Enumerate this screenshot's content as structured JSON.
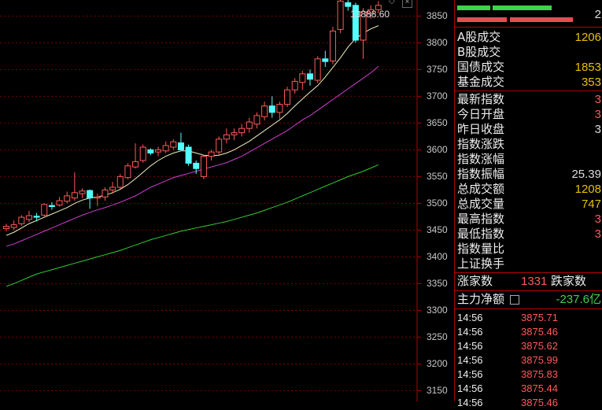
{
  "chart": {
    "high_marker": "13888.60",
    "y_ticks": [
      "3850",
      "3800",
      "3750",
      "3700",
      "3650",
      "3600",
      "3550",
      "3500",
      "3450",
      "3400",
      "3350",
      "3300",
      "3250",
      "3200",
      "3150"
    ],
    "ylim": [
      3130,
      3880
    ],
    "candles": [
      {
        "o": 3453,
        "h": 3462,
        "l": 3448,
        "c": 3457
      },
      {
        "o": 3455,
        "h": 3468,
        "l": 3450,
        "c": 3460
      },
      {
        "o": 3462,
        "h": 3478,
        "l": 3458,
        "c": 3474
      },
      {
        "o": 3470,
        "h": 3486,
        "l": 3465,
        "c": 3477
      },
      {
        "o": 3476,
        "h": 3482,
        "l": 3466,
        "c": 3474
      },
      {
        "o": 3478,
        "h": 3500,
        "l": 3474,
        "c": 3498
      },
      {
        "o": 3496,
        "h": 3502,
        "l": 3488,
        "c": 3494
      },
      {
        "o": 3497,
        "h": 3512,
        "l": 3494,
        "c": 3505
      },
      {
        "o": 3504,
        "h": 3522,
        "l": 3500,
        "c": 3514
      },
      {
        "o": 3510,
        "h": 3558,
        "l": 3505,
        "c": 3520
      },
      {
        "o": 3518,
        "h": 3528,
        "l": 3510,
        "c": 3523
      },
      {
        "o": 3524,
        "h": 3526,
        "l": 3490,
        "c": 3510
      },
      {
        "o": 3510,
        "h": 3518,
        "l": 3495,
        "c": 3512
      },
      {
        "o": 3512,
        "h": 3530,
        "l": 3505,
        "c": 3525
      },
      {
        "o": 3525,
        "h": 3540,
        "l": 3518,
        "c": 3530
      },
      {
        "o": 3530,
        "h": 3555,
        "l": 3526,
        "c": 3550
      },
      {
        "o": 3548,
        "h": 3575,
        "l": 3545,
        "c": 3570
      },
      {
        "o": 3568,
        "h": 3612,
        "l": 3565,
        "c": 3578
      },
      {
        "o": 3580,
        "h": 3610,
        "l": 3576,
        "c": 3605
      },
      {
        "o": 3600,
        "h": 3603,
        "l": 3590,
        "c": 3594
      },
      {
        "o": 3596,
        "h": 3606,
        "l": 3588,
        "c": 3600
      },
      {
        "o": 3598,
        "h": 3616,
        "l": 3594,
        "c": 3608
      },
      {
        "o": 3605,
        "h": 3620,
        "l": 3600,
        "c": 3615
      },
      {
        "o": 3613,
        "h": 3632,
        "l": 3605,
        "c": 3600
      },
      {
        "o": 3605,
        "h": 3610,
        "l": 3570,
        "c": 3575
      },
      {
        "o": 3575,
        "h": 3580,
        "l": 3555,
        "c": 3565
      },
      {
        "o": 3550,
        "h": 3590,
        "l": 3545,
        "c": 3588
      },
      {
        "o": 3588,
        "h": 3600,
        "l": 3580,
        "c": 3596
      },
      {
        "o": 3596,
        "h": 3625,
        "l": 3590,
        "c": 3620
      },
      {
        "o": 3620,
        "h": 3640,
        "l": 3612,
        "c": 3628
      },
      {
        "o": 3628,
        "h": 3640,
        "l": 3618,
        "c": 3632
      },
      {
        "o": 3632,
        "h": 3648,
        "l": 3625,
        "c": 3640
      },
      {
        "o": 3640,
        "h": 3660,
        "l": 3632,
        "c": 3652
      },
      {
        "o": 3648,
        "h": 3670,
        "l": 3640,
        "c": 3664
      },
      {
        "o": 3662,
        "h": 3690,
        "l": 3655,
        "c": 3682
      },
      {
        "o": 3682,
        "h": 3700,
        "l": 3660,
        "c": 3670
      },
      {
        "o": 3670,
        "h": 3690,
        "l": 3658,
        "c": 3685
      },
      {
        "o": 3685,
        "h": 3718,
        "l": 3680,
        "c": 3712
      },
      {
        "o": 3712,
        "h": 3734,
        "l": 3705,
        "c": 3728
      },
      {
        "o": 3726,
        "h": 3748,
        "l": 3712,
        "c": 3742
      },
      {
        "o": 3742,
        "h": 3750,
        "l": 3720,
        "c": 3732
      },
      {
        "o": 3730,
        "h": 3775,
        "l": 3725,
        "c": 3770
      },
      {
        "o": 3770,
        "h": 3785,
        "l": 3755,
        "c": 3765
      },
      {
        "o": 3766,
        "h": 3830,
        "l": 3760,
        "c": 3822
      },
      {
        "o": 3825,
        "h": 3880,
        "l": 3818,
        "c": 3878
      },
      {
        "o": 3875,
        "h": 3888,
        "l": 3860,
        "c": 3868
      },
      {
        "o": 3870,
        "h": 3875,
        "l": 3800,
        "c": 3805
      },
      {
        "o": 3805,
        "h": 3865,
        "l": 3770,
        "c": 3858
      },
      {
        "o": 3855,
        "h": 3870,
        "l": 3845,
        "c": 3862
      },
      {
        "o": 3862,
        "h": 3878,
        "l": 3855,
        "c": 3870
      }
    ],
    "ma5": [
      3440,
      3446,
      3454,
      3462,
      3468,
      3474,
      3480,
      3486,
      3492,
      3500,
      3506,
      3510,
      3512,
      3515,
      3520,
      3526,
      3535,
      3546,
      3558,
      3570,
      3580,
      3588,
      3594,
      3598,
      3598,
      3594,
      3590,
      3589,
      3590,
      3594,
      3600,
      3608,
      3616,
      3626,
      3636,
      3646,
      3656,
      3668,
      3682,
      3695,
      3708,
      3720,
      3736,
      3754,
      3772,
      3792,
      3808,
      3818,
      3826,
      3832
    ],
    "ma10": [
      3420,
      3424,
      3430,
      3436,
      3442,
      3448,
      3454,
      3460,
      3466,
      3472,
      3478,
      3483,
      3488,
      3492,
      3497,
      3502,
      3508,
      3514,
      3522,
      3530,
      3536,
      3542,
      3548,
      3552,
      3556,
      3560,
      3564,
      3568,
      3572,
      3576,
      3582,
      3588,
      3596,
      3604,
      3612,
      3620,
      3628,
      3636,
      3646,
      3656,
      3664,
      3674,
      3684,
      3694,
      3704,
      3714,
      3724,
      3734,
      3744,
      3756
    ],
    "ma30": [
      3345,
      3350,
      3356,
      3362,
      3368,
      3372,
      3376,
      3380,
      3384,
      3388,
      3392,
      3396,
      3400,
      3404,
      3408,
      3412,
      3417,
      3422,
      3427,
      3432,
      3436,
      3440,
      3444,
      3448,
      3451,
      3454,
      3457,
      3460,
      3463,
      3466,
      3470,
      3474,
      3478,
      3482,
      3487,
      3492,
      3497,
      3502,
      3508,
      3514,
      3520,
      3526,
      3532,
      3538,
      3544,
      3550,
      3555,
      3560,
      3566,
      3572
    ]
  },
  "panel": {
    "top_value": "2",
    "a_share": {
      "label": "A股成交",
      "value": "1206"
    },
    "b_share": {
      "label": "B股成交",
      "value": ""
    },
    "treasury": {
      "label": "国债成交",
      "value": "1853"
    },
    "fund": {
      "label": "基金成交",
      "value": "353"
    },
    "latest_index": {
      "label": "最新指数",
      "value": "3"
    },
    "today_open": {
      "label": "今日开盘",
      "value": "3"
    },
    "prev_close": {
      "label": "昨日收盘",
      "value": "3"
    },
    "change": {
      "label": "指数涨跌",
      "value": ""
    },
    "change_pct": {
      "label": "指数涨幅",
      "value": ""
    },
    "amplitude": {
      "label": "指数振幅",
      "value": "25.39"
    },
    "total_amount": {
      "label": "总成交额",
      "value": "1208"
    },
    "total_volume": {
      "label": "总成交量",
      "value": "747"
    },
    "high": {
      "label": "最高指数",
      "value": "3"
    },
    "low": {
      "label": "最低指数",
      "value": "3"
    },
    "vol_ratio": {
      "label": "指数量比",
      "value": ""
    },
    "turnover": {
      "label": "上证换手",
      "value": ""
    },
    "advancers_label": "涨家数",
    "advancers_value": "1331",
    "decliners_label": "跌家数",
    "net_flow_label": "主力净额",
    "net_flow_value": "-237.6亿",
    "ticks": [
      {
        "time": "14:56",
        "price": "3875.71"
      },
      {
        "time": "14:56",
        "price": "3875.46"
      },
      {
        "time": "14:56",
        "price": "3875.62"
      },
      {
        "time": "14:56",
        "price": "3875.99"
      },
      {
        "time": "14:56",
        "price": "3875.83"
      },
      {
        "time": "14:56",
        "price": "3875.44"
      },
      {
        "time": "14:56",
        "price": "3875.46"
      }
    ]
  }
}
